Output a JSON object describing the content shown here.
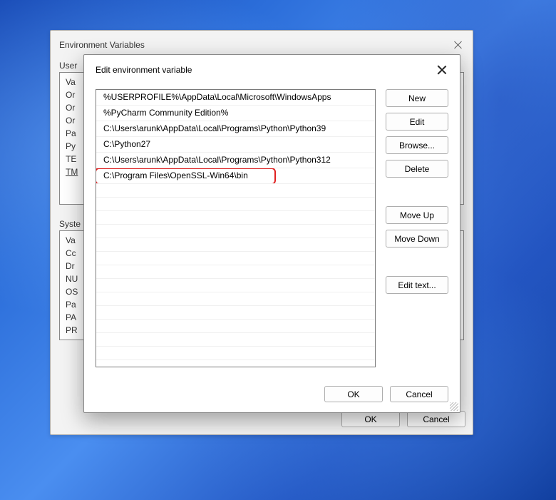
{
  "parent": {
    "title": "Environment Variables",
    "user_section_label": "User",
    "user_items": [
      "Va",
      "Or",
      "Or",
      "Or",
      "Pa",
      "Py",
      "TE",
      "TM"
    ],
    "system_section_label": "Syste",
    "system_items": [
      "Va",
      "Cc",
      "Dr",
      "NU",
      "OS",
      "Pa",
      "PA",
      "PR"
    ],
    "ok": "OK",
    "cancel": "Cancel"
  },
  "child": {
    "title": "Edit environment variable",
    "entries": [
      "%USERPROFILE%\\AppData\\Local\\Microsoft\\WindowsApps",
      "%PyCharm Community Edition%",
      "C:\\Users\\arunk\\AppData\\Local\\Programs\\Python\\Python39",
      "C:\\Python27",
      "C:\\Users\\arunk\\AppData\\Local\\Programs\\Python\\Python312",
      "C:\\Program Files\\OpenSSL-Win64\\bin"
    ],
    "highlight_index": 5,
    "buttons": {
      "new": "New",
      "edit": "Edit",
      "browse": "Browse...",
      "delete": "Delete",
      "move_up": "Move Up",
      "move_down": "Move Down",
      "edit_text": "Edit text..."
    },
    "ok": "OK",
    "cancel": "Cancel"
  }
}
